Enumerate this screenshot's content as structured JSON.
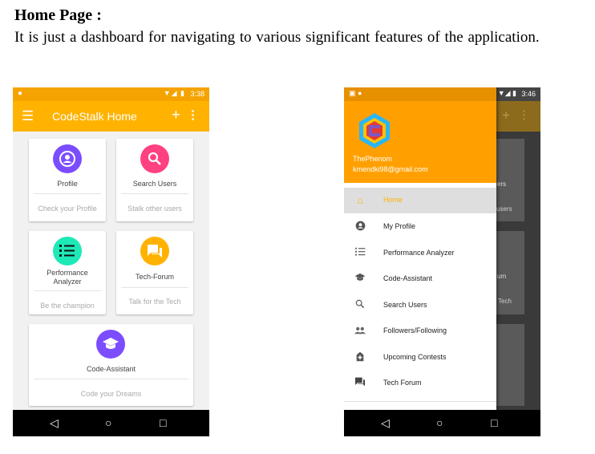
{
  "doc": {
    "heading": "Home Page :",
    "paragraph": "It is just a dashboard for navigating to various significant features of the application."
  },
  "phone1": {
    "status_time": "3:38",
    "app_title": "CodeStalk Home",
    "cards": [
      {
        "title": "Profile",
        "subtitle": "Check your Profile",
        "icon": "account-circle-icon",
        "color": "#7c4dff"
      },
      {
        "title": "Search Users",
        "subtitle": "Stalk other users",
        "icon": "search-icon",
        "color": "#ff4081"
      },
      {
        "title": "Performance Analyzer",
        "subtitle": "Be the champion",
        "icon": "list-numbered-icon",
        "color": "#1de9b6"
      },
      {
        "title": "Tech-Forum",
        "subtitle": "Talk for the Tech",
        "icon": "forum-icon",
        "color": "#ffb300"
      },
      {
        "title": "Code-Assistant",
        "subtitle": "Code your Dreams",
        "icon": "school-icon",
        "color": "#7c4dff"
      }
    ]
  },
  "phone2": {
    "status_time": "3:46",
    "user_name": "ThePhenom",
    "user_email": "kmendki98@gmail.com",
    "behind_texts": [
      "ers",
      "users",
      "um",
      "Tech"
    ],
    "menu": [
      {
        "label": "Home",
        "icon": "home-icon",
        "active": true
      },
      {
        "label": "My Profile",
        "icon": "account-circle-icon",
        "active": false
      },
      {
        "label": "Performance Analyzer",
        "icon": "list-numbered-icon",
        "active": false
      },
      {
        "label": "Code-Assistant",
        "icon": "school-icon",
        "active": false
      },
      {
        "label": "Search Users",
        "icon": "search-icon",
        "active": false
      },
      {
        "label": "Followers/Following",
        "icon": "people-icon",
        "active": false
      },
      {
        "label": "Upcoming Contests",
        "icon": "hospital-plus-icon",
        "active": false
      },
      {
        "label": "Tech Forum",
        "icon": "forum-icon",
        "active": false
      }
    ]
  },
  "colors": {
    "accent": "#ffb300",
    "accent_dark": "#f5a300",
    "drawer_active_bg": "#dedede"
  }
}
